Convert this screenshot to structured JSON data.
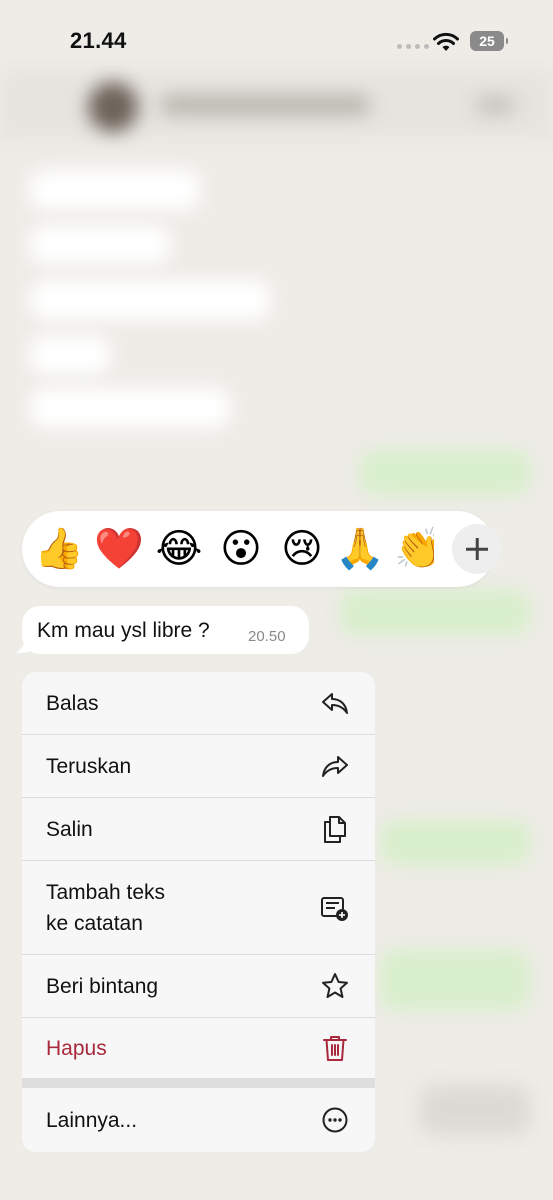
{
  "status_bar": {
    "time": "21.44",
    "battery": "25"
  },
  "reactions": {
    "emojis": [
      "👍",
      "❤️",
      "😂",
      "😮",
      "😢",
      "🙏",
      "👏"
    ],
    "more_icon": "plus-icon"
  },
  "message": {
    "text": "Km mau ysl libre ?",
    "time": "20.50"
  },
  "menu": {
    "items": [
      {
        "label": "Balas",
        "icon": "reply-icon"
      },
      {
        "label": "Teruskan",
        "icon": "forward-icon"
      },
      {
        "label": "Salin",
        "icon": "copy-icon"
      },
      {
        "label": "Tambah teks\nke catatan",
        "icon": "add-note-icon"
      },
      {
        "label": "Beri bintang",
        "icon": "star-icon"
      },
      {
        "label": "Hapus",
        "icon": "trash-icon",
        "color": "#a8283c"
      },
      {
        "label": "Lainnya...",
        "icon": "more-icon"
      }
    ]
  }
}
